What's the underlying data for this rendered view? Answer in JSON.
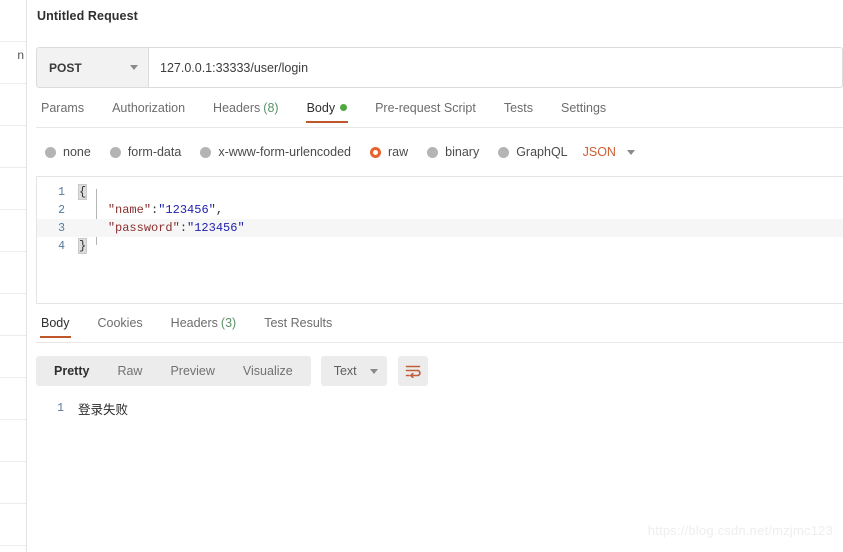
{
  "sidebar": {
    "truncated_label": "n",
    "row_count": 13
  },
  "request": {
    "title": "Untitled Request",
    "method": "POST",
    "url": "127.0.0.1:33333/user/login",
    "tabs": [
      {
        "label": "Params",
        "badge": "",
        "dot": false,
        "active": false
      },
      {
        "label": "Authorization",
        "badge": "",
        "dot": false,
        "active": false
      },
      {
        "label": "Headers",
        "badge": "(8)",
        "dot": false,
        "active": false
      },
      {
        "label": "Body",
        "badge": "",
        "dot": true,
        "active": true
      },
      {
        "label": "Pre-request Script",
        "badge": "",
        "dot": false,
        "active": false
      },
      {
        "label": "Tests",
        "badge": "",
        "dot": false,
        "active": false
      },
      {
        "label": "Settings",
        "badge": "",
        "dot": false,
        "active": false
      }
    ],
    "body_types": [
      {
        "label": "none",
        "selected": false
      },
      {
        "label": "form-data",
        "selected": false
      },
      {
        "label": "x-www-form-urlencoded",
        "selected": false
      },
      {
        "label": "raw",
        "selected": true
      },
      {
        "label": "binary",
        "selected": false
      },
      {
        "label": "GraphQL",
        "selected": false
      }
    ],
    "raw_format": "JSON",
    "body_lines": [
      {
        "n": "1",
        "brace": "{",
        "key": "",
        "colon": "",
        "value": "",
        "comma": ""
      },
      {
        "n": "2",
        "brace": "",
        "key": "\"name\"",
        "colon": ":",
        "value": "\"123456\"",
        "comma": ","
      },
      {
        "n": "3",
        "brace": "",
        "key": "\"password\"",
        "colon": ":",
        "value": "\"123456\"",
        "comma": ""
      },
      {
        "n": "4",
        "brace": "}",
        "key": "",
        "colon": "",
        "value": "",
        "comma": ""
      }
    ]
  },
  "response": {
    "tabs": [
      {
        "label": "Body",
        "badge": "",
        "active": true
      },
      {
        "label": "Cookies",
        "badge": "",
        "active": false
      },
      {
        "label": "Headers",
        "badge": "(3)",
        "active": false
      },
      {
        "label": "Test Results",
        "badge": "",
        "active": false
      }
    ],
    "view_modes": [
      {
        "label": "Pretty",
        "active": true
      },
      {
        "label": "Raw",
        "active": false
      },
      {
        "label": "Preview",
        "active": false
      },
      {
        "label": "Visualize",
        "active": false
      }
    ],
    "format": "Text",
    "wrap_icon": "word-wrap-icon",
    "body_lines": [
      {
        "n": "1",
        "text": "登录失败"
      }
    ]
  },
  "watermark": "https://blog.csdn.net/mzjmc123",
  "colors": {
    "accent_orange": "#c2562b",
    "raw_radio_orange": "#e7622c",
    "json_label_orange": "#cf5f33",
    "green_badge": "#5a9167",
    "green_dot": "#4fa83d",
    "key_maroon": "#8b2f2f",
    "value_blue": "#2222b0",
    "line_number_blue": "#56799a"
  }
}
